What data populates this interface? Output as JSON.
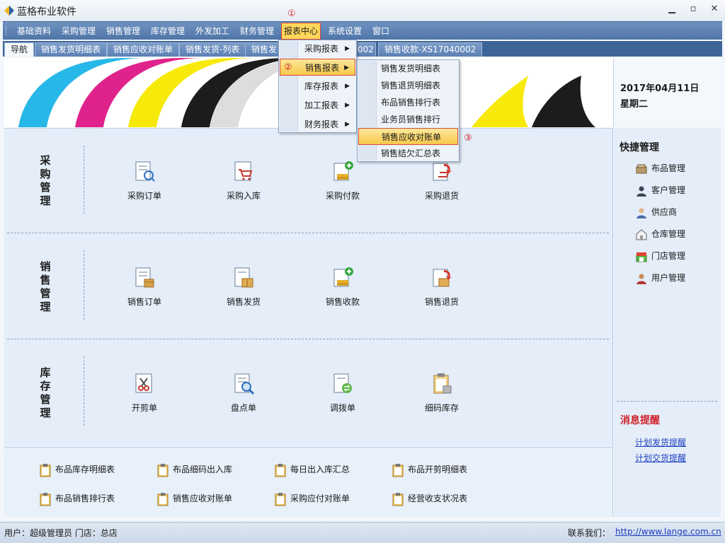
{
  "window": {
    "title": "蓝格布业软件",
    "controls": {
      "minimize": "▁",
      "restore": "▫",
      "close": "✕"
    }
  },
  "menu": {
    "items": [
      {
        "label": "基础资料",
        "active": false
      },
      {
        "label": "采购管理",
        "active": false
      },
      {
        "label": "销售管理",
        "active": false
      },
      {
        "label": "库存管理",
        "active": false
      },
      {
        "label": "外发加工",
        "active": false
      },
      {
        "label": "财务管理",
        "active": false
      },
      {
        "label": "报表中心",
        "active": true
      },
      {
        "label": "系统设置",
        "active": false
      },
      {
        "label": "窗口",
        "active": false
      }
    ]
  },
  "tabs": [
    {
      "label": "导航"
    },
    {
      "label": "销售发货明细表"
    },
    {
      "label": "销售应收对账单"
    },
    {
      "label": "销售发货-列表"
    },
    {
      "label": "销售发"
    },
    {
      "label": "002"
    },
    {
      "label": "销售收款-XS17040002"
    }
  ],
  "date": {
    "date": "2017年04月11日",
    "weekday": "星期二"
  },
  "dropdown": {
    "items": [
      {
        "label": "采购报表",
        "arrow": "▶"
      },
      {
        "label": "销售报表",
        "arrow": "▶",
        "active": true
      },
      {
        "label": "库存报表",
        "arrow": "▶"
      },
      {
        "label": "加工报表",
        "arrow": "▶"
      },
      {
        "label": "财务报表",
        "arrow": "▶"
      }
    ]
  },
  "submenu": {
    "items": [
      {
        "label": "销售发货明细表"
      },
      {
        "label": "销售退货明细表"
      },
      {
        "label": "布品销售排行表"
      },
      {
        "label": "业务员销售排行"
      },
      {
        "label": "销售应收对账单",
        "active": true
      },
      {
        "label": "销售结欠汇总表"
      }
    ]
  },
  "markers": {
    "m1": "①",
    "m2": "②",
    "m3": "③"
  },
  "sections": [
    {
      "title": "采购管理",
      "chars": [
        "采",
        "购",
        "管",
        "理"
      ],
      "tiles": [
        {
          "label": "采购订单",
          "icon": "order-icon"
        },
        {
          "label": "采购入库",
          "icon": "cart-icon"
        },
        {
          "label": "采购付款",
          "icon": "payment-icon"
        },
        {
          "label": "采购退货",
          "icon": "return-icon"
        }
      ]
    },
    {
      "title": "销售管理",
      "chars": [
        "销",
        "售",
        "管",
        "理"
      ],
      "tiles": [
        {
          "label": "销售订单",
          "icon": "order-box-icon"
        },
        {
          "label": "销售发货",
          "icon": "shipping-icon"
        },
        {
          "label": "销售收款",
          "icon": "receipt-icon"
        },
        {
          "label": "销售退货",
          "icon": "return-icon"
        }
      ]
    },
    {
      "title": "库存管理",
      "chars": [
        "库",
        "存",
        "管",
        "理"
      ],
      "tiles": [
        {
          "label": "开剪单",
          "icon": "scissors-icon"
        },
        {
          "label": "盘点单",
          "icon": "magnifier-icon"
        },
        {
          "label": "调拨单",
          "icon": "transfer-icon"
        },
        {
          "label": "细码库存",
          "icon": "clipboard-icon"
        }
      ]
    }
  ],
  "reports": [
    {
      "label": "布品库存明细表"
    },
    {
      "label": "布品细码出入库"
    },
    {
      "label": "每日出入库汇总"
    },
    {
      "label": "布品开剪明细表"
    },
    {
      "label": "布品销售排行表"
    },
    {
      "label": "销售应收对账单"
    },
    {
      "label": "采购应付对账单"
    },
    {
      "label": "经营收支状况表"
    }
  ],
  "quick": {
    "title": "快捷管理",
    "items": [
      {
        "label": "布品管理",
        "icon": "fabric-icon"
      },
      {
        "label": "客户管理",
        "icon": "customer-icon"
      },
      {
        "label": "供应商",
        "icon": "supplier-icon"
      },
      {
        "label": "仓库管理",
        "icon": "warehouse-icon"
      },
      {
        "label": "门店管理",
        "icon": "store-icon"
      },
      {
        "label": "用户管理",
        "icon": "user-icon"
      }
    ]
  },
  "reminders": {
    "title": "消息提醒",
    "links": [
      {
        "label": "计划发货提醒"
      },
      {
        "label": "计划交货提醒"
      }
    ]
  },
  "status": {
    "user": "用户：超级管理员  门店：总店",
    "contact": "联系我们：",
    "url": "http://www.lange.com.cn"
  },
  "colors": {
    "accent": "#4f75a8",
    "highlight": "#ffd65a",
    "marker": "#d0212a",
    "link": "#1d3fc0"
  }
}
